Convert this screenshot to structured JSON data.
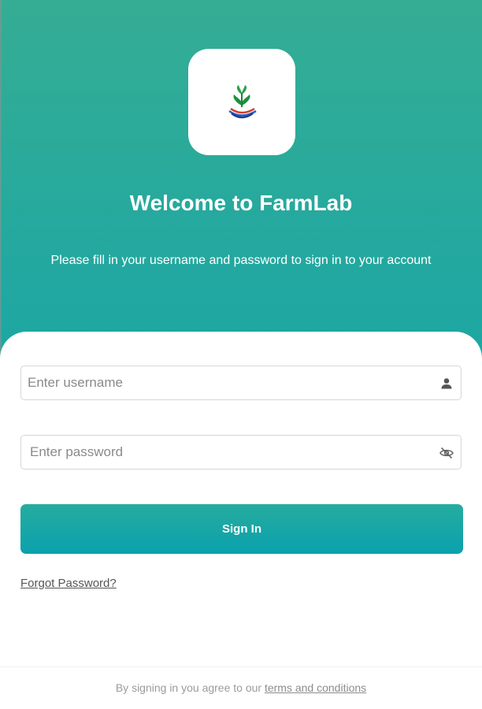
{
  "app": {
    "title": "Welcome to FarmLab",
    "subtitle": "Please fill in your username and password to sign in to your account",
    "logo_icon": "farmlab-sprout-logo-icon"
  },
  "form": {
    "username": {
      "placeholder": "Enter username",
      "value": "",
      "icon": "person-icon"
    },
    "password": {
      "placeholder": "Enter password",
      "value": "",
      "icon": "eye-off-icon"
    },
    "signin_label": "Sign In",
    "forgot_label": "Forgot Password?"
  },
  "footer": {
    "text": "By signing in you agree to our",
    "terms_label": "terms and conditions"
  },
  "colors": {
    "gradient_top": "#35ad94",
    "gradient_bottom": "#12a3a8",
    "button_top": "#26ac9f",
    "button_bottom": "#0aa1ad",
    "card": "#ffffff"
  }
}
